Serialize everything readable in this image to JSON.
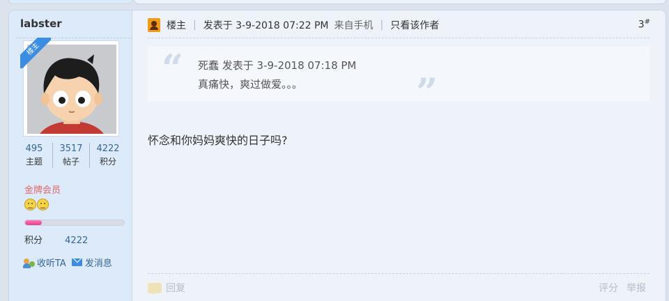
{
  "user": {
    "username": "labster",
    "badge": "楼主",
    "stats": [
      {
        "value": "495",
        "label": "主题"
      },
      {
        "value": "3517",
        "label": "帖子"
      },
      {
        "value": "4222",
        "label": "积分"
      }
    ],
    "rank": "金牌会员",
    "rank_icons": [
      "smiley-icon",
      "smiley-icon"
    ],
    "level_progress": 0.17,
    "points_label": "积分",
    "points_value": "4222",
    "follow_label": "收听TA",
    "message_label": "发消息"
  },
  "post": {
    "host_label": "楼主",
    "posted_at": "发表于 3-9-2018 07:22 PM",
    "source": "来自手机",
    "only_author": "只看该作者",
    "floor": "3",
    "floor_mark": "#",
    "quote": {
      "line1": "死蠢 发表于 3-9-2018 07:18 PM",
      "line2": "真痛快，爽过做爱。。。"
    },
    "message": "怀念和你妈妈爽快的日子吗?",
    "reply_label": "回复",
    "rate_label": "评分",
    "report_label": "举报"
  },
  "colors": {
    "link": "#336699",
    "rank": "#e06666",
    "badge": "#3a8de0",
    "progress": "#e43e8f"
  }
}
